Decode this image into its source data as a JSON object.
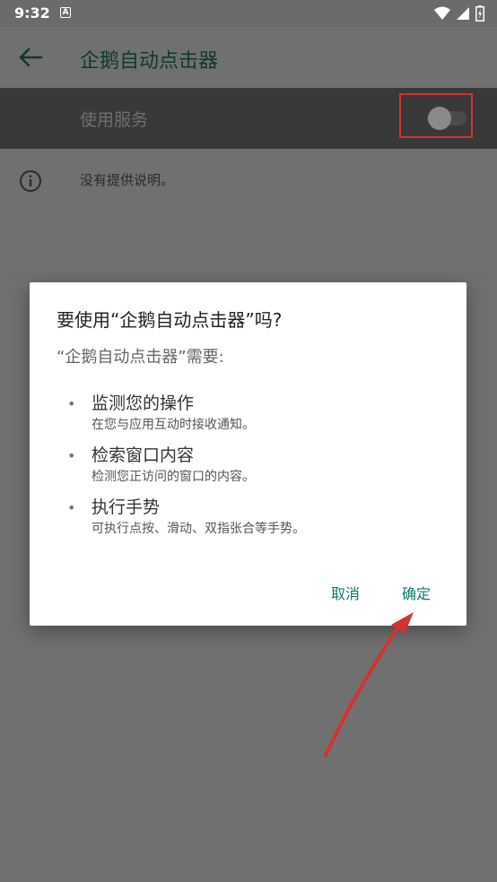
{
  "status_bar": {
    "time": "9:32",
    "notification_letter": "A",
    "icons": [
      "wifi-icon",
      "signal-icon",
      "battery-icon"
    ]
  },
  "app_bar": {
    "title": "企鹅自动点击器",
    "back_icon": "arrow-left-icon"
  },
  "service": {
    "label": "使用服务",
    "toggle_on": false
  },
  "info": {
    "icon": "info-icon",
    "text": "没有提供说明。"
  },
  "dialog": {
    "title": "要使用“企鹅自动点击器”吗?",
    "subtitle": "“企鹅自动点击器”需要:",
    "permissions": [
      {
        "title": "监测您的操作",
        "desc": "在您与应用互动时接收通知。"
      },
      {
        "title": "检索窗口内容",
        "desc": "检测您正访问的窗口的内容。"
      },
      {
        "title": "执行手势",
        "desc": "可执行点按、滑动、双指张合等手势。"
      }
    ],
    "bullet": "•",
    "cancel_label": "取消",
    "ok_label": "确定"
  },
  "colors": {
    "accent": "#0e7a6c",
    "annotation": "#d5322f",
    "scrim": "#707070"
  }
}
